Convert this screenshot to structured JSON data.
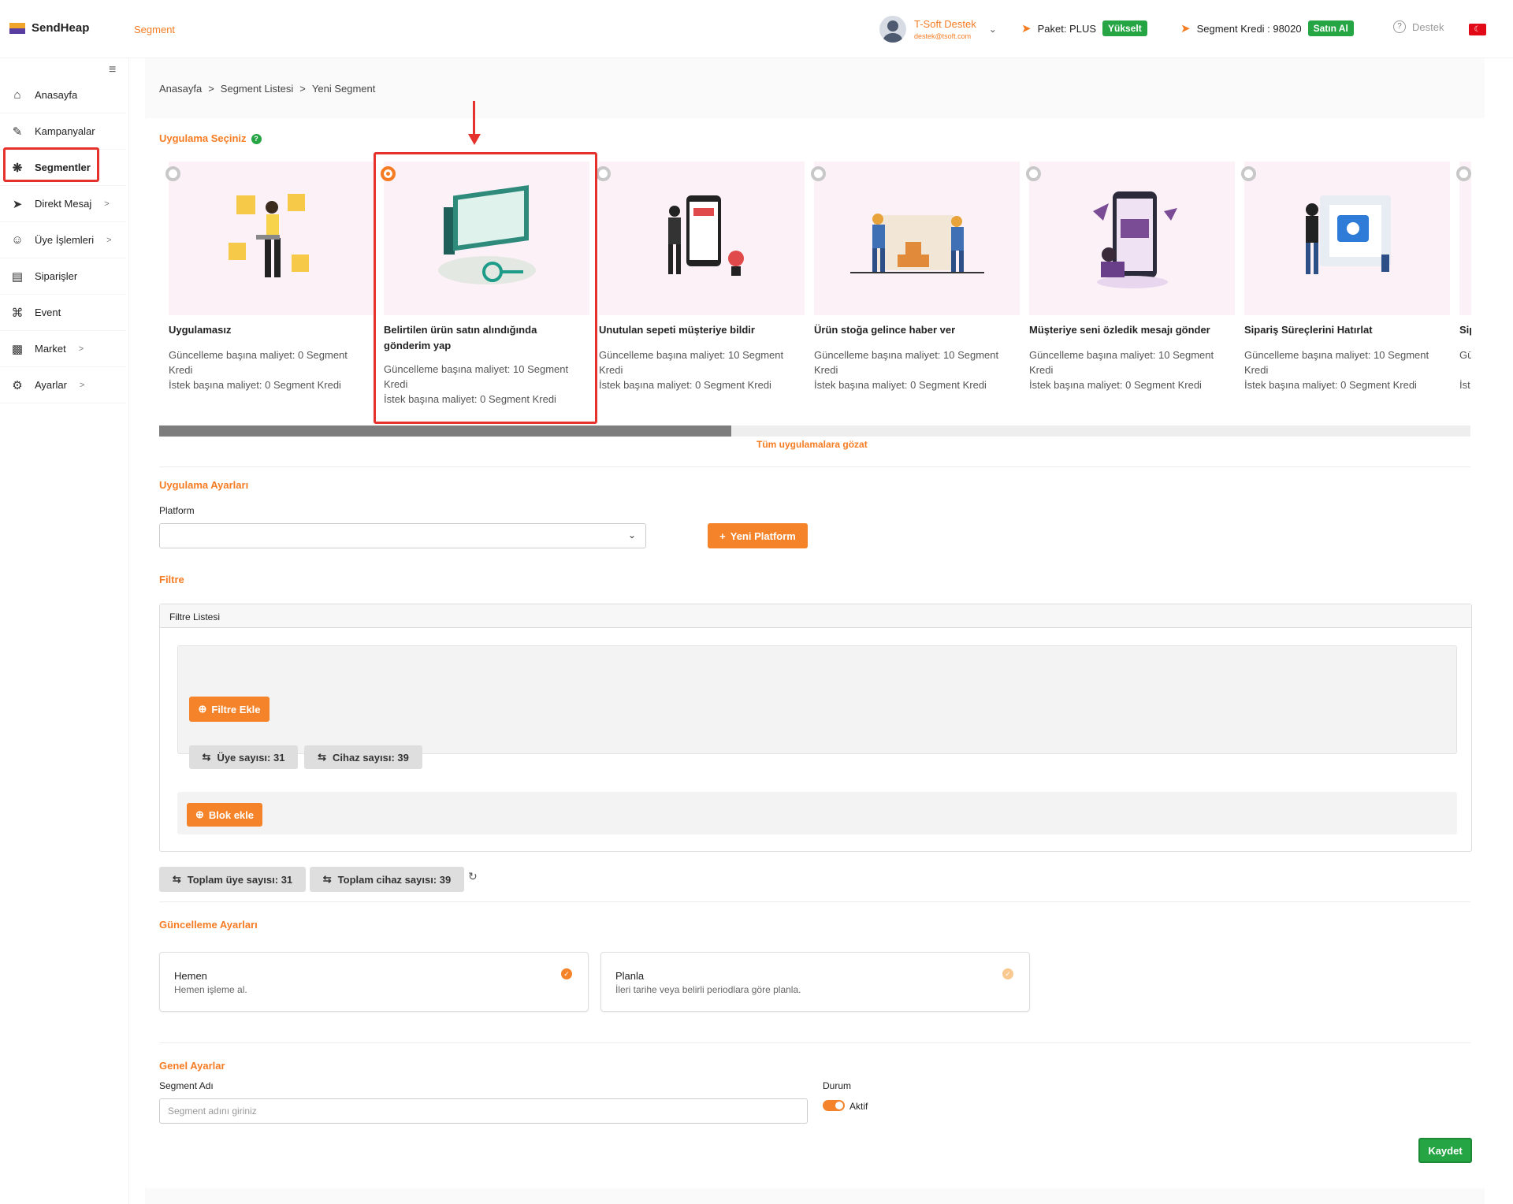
{
  "app": {
    "name": "SendHeap",
    "page_title": "Segment"
  },
  "user": {
    "name": "T-Soft Destek",
    "email": "destek@tsoft.com"
  },
  "topbar": {
    "package_label": "Paket: PLUS",
    "upgrade_label": "Yükselt",
    "credit_label": "Segment Kredi : 98020",
    "buy_label": "Satın Al",
    "support_label": "Destek"
  },
  "sidebar": {
    "items": [
      {
        "label": "Anasayfa",
        "icon": "home-icon"
      },
      {
        "label": "Kampanyalar",
        "icon": "megaphone-icon"
      },
      {
        "label": "Segmentler",
        "icon": "segments-icon"
      },
      {
        "label": "Direkt Mesaj",
        "icon": "send-icon"
      },
      {
        "label": "Üye İşlemleri",
        "icon": "users-icon"
      },
      {
        "label": "Siparişler",
        "icon": "cart-icon"
      },
      {
        "label": "Event",
        "icon": "command-icon"
      },
      {
        "label": "Market",
        "icon": "store-icon"
      },
      {
        "label": "Ayarlar",
        "icon": "gear-icon"
      }
    ]
  },
  "breadcrumb": {
    "home": "Anasayfa",
    "sep": ">",
    "list": "Segment Listesi",
    "current": "Yeni Segment"
  },
  "app_select": {
    "title": "Uygulama Seçiniz",
    "browse_label": "Tüm uygulamalara gözat",
    "apps": [
      {
        "title": "Uygulamasız",
        "desc1": "Güncelleme başına maliyet: 0 Segment Kredi",
        "desc2": "İstek başına maliyet: 0 Segment Kredi",
        "selected": false
      },
      {
        "title": "Belirtilen ürün satın alındığında gönderim yap",
        "desc1": "Güncelleme başına maliyet: 10 Segment Kredi",
        "desc2": "İstek başına maliyet: 0 Segment Kredi",
        "selected": true
      },
      {
        "title": "Unutulan sepeti müşteriye bildir",
        "desc1": "Güncelleme başına maliyet: 10 Segment Kredi",
        "desc2": "İstek başına maliyet: 0 Segment Kredi",
        "selected": false
      },
      {
        "title": "Ürün stoğa gelince haber ver",
        "desc1": "Güncelleme başına maliyet: 10 Segment Kredi",
        "desc2": "İstek başına maliyet: 0 Segment Kredi",
        "selected": false
      },
      {
        "title": "Müşteriye seni özledik mesajı gönder",
        "desc1": "Güncelleme başına maliyet: 10 Segment Kredi",
        "desc2": "İstek başına maliyet: 0 Segment Kredi",
        "selected": false
      },
      {
        "title": "Sipariş Süreçlerini Hatırlat",
        "desc1": "Güncelleme başına maliyet: 10 Segment Kredi",
        "desc2": "İstek başına maliyet: 0 Segment Kredi",
        "selected": false
      },
      {
        "title": "Sip",
        "desc1": "Gü Kr",
        "desc2": "İst",
        "selected": false
      }
    ]
  },
  "app_settings": {
    "title": "Uygulama Ayarları",
    "platform_label": "Platform",
    "platform_value": "",
    "new_platform_label": "Yeni Platform"
  },
  "filter": {
    "title": "Filtre",
    "list_title": "Filtre Listesi",
    "add_filter_label": "Filtre Ekle",
    "member_count": "Üye sayısı: 31",
    "device_count": "Cihaz sayısı: 39",
    "add_block_label": "Blok ekle",
    "total_members": "Toplam üye sayısı: 31",
    "total_devices": "Toplam cihaz sayısı: 39"
  },
  "update_settings": {
    "title": "Güncelleme Ayarları",
    "options": [
      {
        "title": "Hemen",
        "desc": "Hemen işleme al.",
        "selected": true
      },
      {
        "title": "Planla",
        "desc": "İleri tarihe veya belirli periodlara göre planla.",
        "selected": false
      }
    ]
  },
  "general": {
    "title": "Genel Ayarlar",
    "name_label": "Segment Adı",
    "name_placeholder": "Segment adını giriniz",
    "status_label": "Durum",
    "status_value": "Aktif",
    "save_label": "Kaydet"
  },
  "colors": {
    "accent": "#f57c23",
    "success": "#26a545",
    "highlight": "#e5322d"
  }
}
